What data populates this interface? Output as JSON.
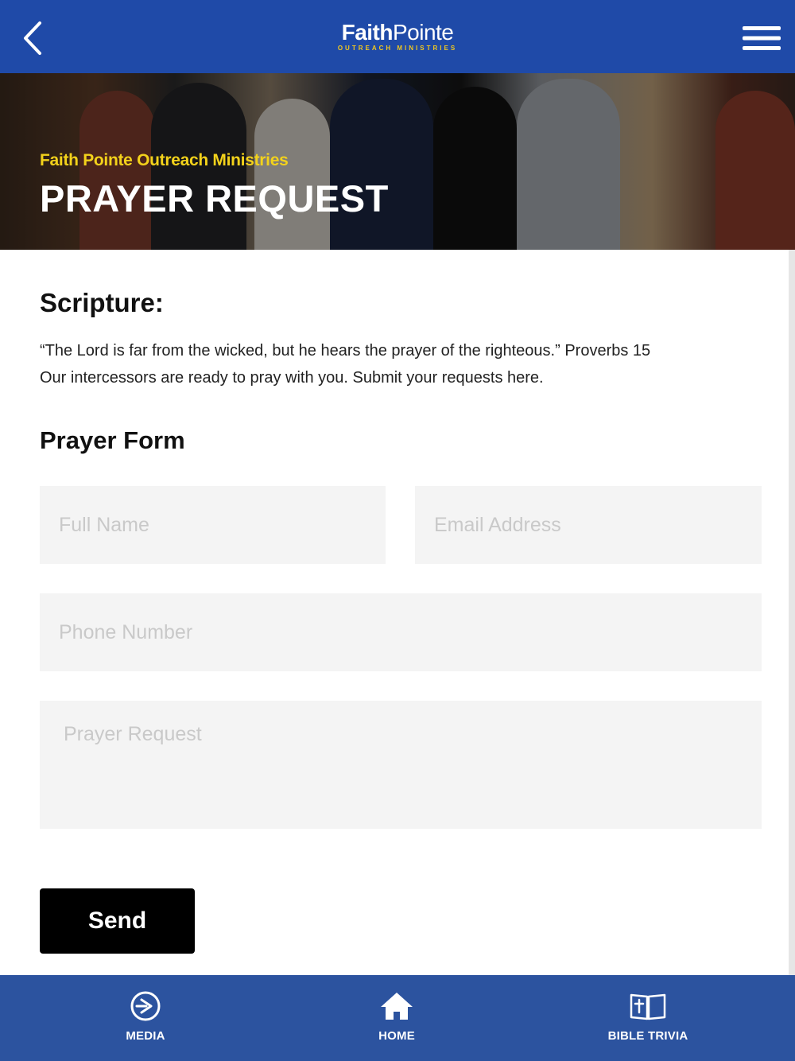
{
  "header": {
    "logo_bold": "Faith",
    "logo_light": "Pointe",
    "logo_sub": "OUTREACH MINISTRIES",
    "back_icon": "chevron-left-icon",
    "menu_icon": "hamburger-menu-icon"
  },
  "hero": {
    "eyebrow": "Faith Pointe Outreach Ministries",
    "title": "PRAYER REQUEST"
  },
  "scripture": {
    "heading": "Scripture:",
    "line1": "“The Lord is far from the wicked, but he hears the prayer of the righteous.” Proverbs 15",
    "line2": "Our intercessors are ready to pray with you. Submit your requests here."
  },
  "form": {
    "heading": "Prayer Form",
    "full_name": {
      "placeholder": "Full Name",
      "value": ""
    },
    "email": {
      "placeholder": "Email Address",
      "value": ""
    },
    "phone": {
      "placeholder": "Phone Number",
      "value": ""
    },
    "request": {
      "placeholder": "Prayer Request",
      "value": ""
    },
    "send_label": "Send"
  },
  "tabs": [
    {
      "label": "MEDIA",
      "icon": "play-circle-icon"
    },
    {
      "label": "HOME",
      "icon": "home-icon"
    },
    {
      "label": "BIBLE TRIVIA",
      "icon": "bible-icon"
    }
  ],
  "colors": {
    "header_bg": "#1f4aa8",
    "tabbar_bg": "#2c539f",
    "accent_yellow": "#f3d21b",
    "button_bg": "#000000",
    "field_bg": "#f4f4f4"
  }
}
